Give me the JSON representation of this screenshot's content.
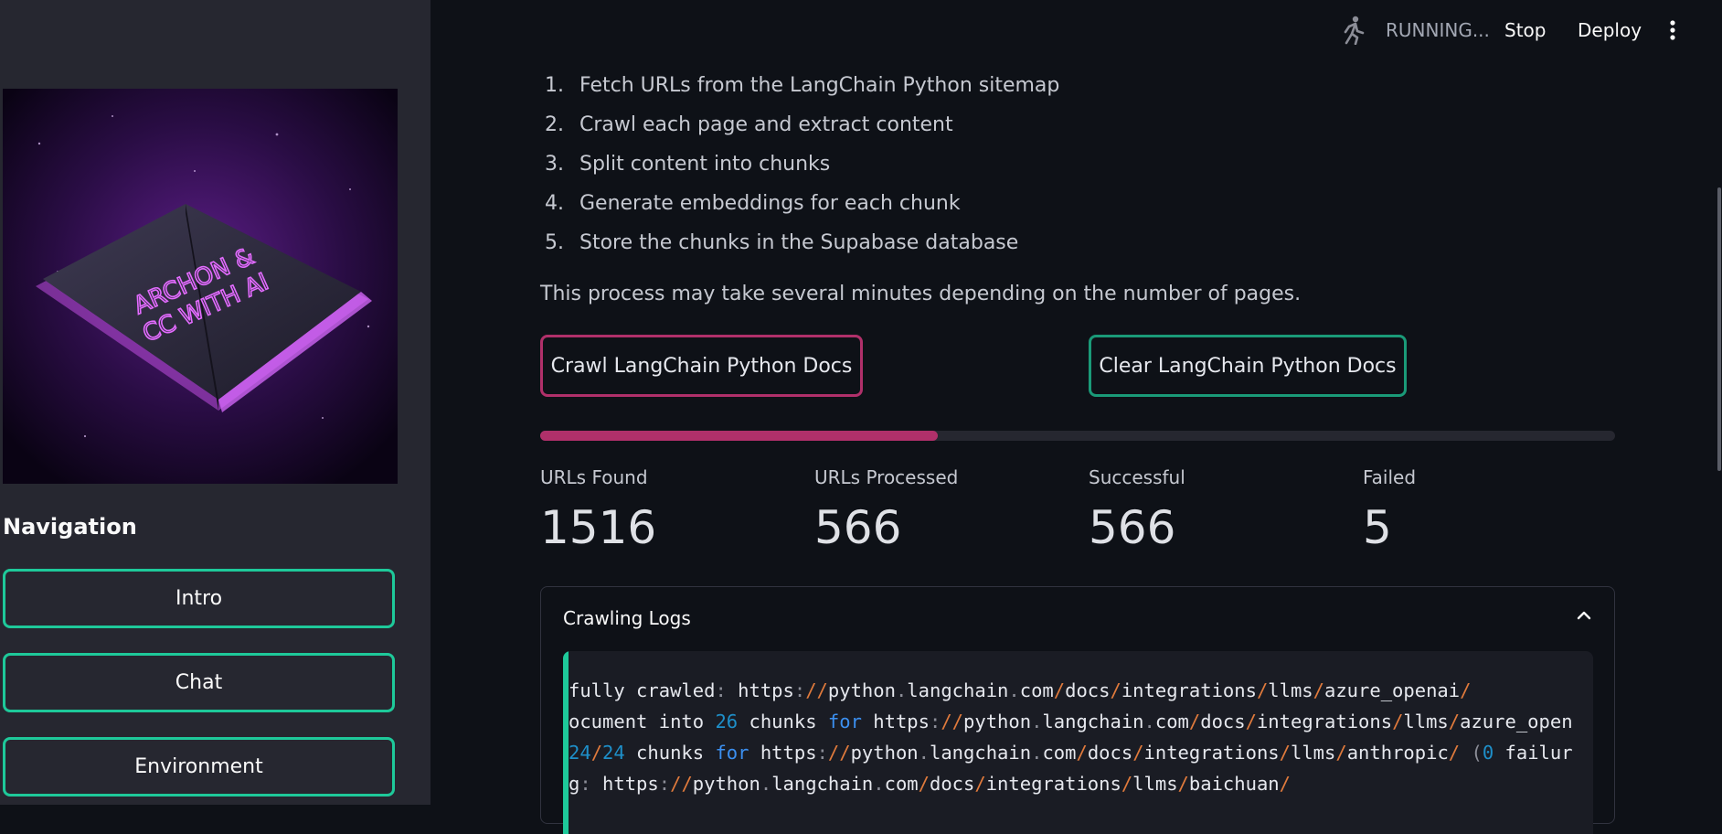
{
  "header": {
    "running_icon": "running-person-icon",
    "status_text": "RUNNING...",
    "stop_label": "Stop",
    "deploy_label": "Deploy",
    "menu_icon": "vertical-ellipsis-icon"
  },
  "sidebar": {
    "image_alt": "book-logo-image",
    "image_text_line1": "ARCHON &",
    "image_text_line2": "CC WITH AI",
    "navigation_heading": "Navigation",
    "nav_items": [
      {
        "label": "Intro"
      },
      {
        "label": "Chat"
      },
      {
        "label": "Environment"
      }
    ]
  },
  "main": {
    "steps": [
      {
        "num": "1.",
        "text": "Fetch URLs from the LangChain Python sitemap"
      },
      {
        "num": "2.",
        "text": "Crawl each page and extract content"
      },
      {
        "num": "3.",
        "text": "Split content into chunks"
      },
      {
        "num": "4.",
        "text": "Generate embeddings for each chunk"
      },
      {
        "num": "5.",
        "text": "Store the chunks in the Supabase database"
      }
    ],
    "note": "This process may take several minutes depending on the number of pages.",
    "crawl_button": "Crawl LangChain Python Docs",
    "clear_button": "Clear LangChain Python Docs",
    "progress_fraction": 0.37,
    "metrics": [
      {
        "label": "URLs Found",
        "value": "1516"
      },
      {
        "label": "URLs Processed",
        "value": "566"
      },
      {
        "label": "Successful",
        "value": "566"
      },
      {
        "label": "Failed",
        "value": "5"
      }
    ],
    "logs": {
      "title": "Crawling Logs",
      "chevron_icon": "chevron-up-icon",
      "lines": [
        "fully crawled: https://python.langchain.com/docs/integrations/llms/azure_openai/",
        "ocument into 26 chunks for https://python.langchain.com/docs/integrations/llms/azure_open",
        "24/24 chunks for https://python.langchain.com/docs/integrations/llms/anthropic/ (0 failur",
        "g: https://python.langchain.com/docs/integrations/llms/baichuan/"
      ]
    }
  },
  "colors": {
    "accent_pink": "#b0306a",
    "accent_green": "#1ec99a",
    "background": "#0e1117",
    "sidebar": "#262730"
  }
}
